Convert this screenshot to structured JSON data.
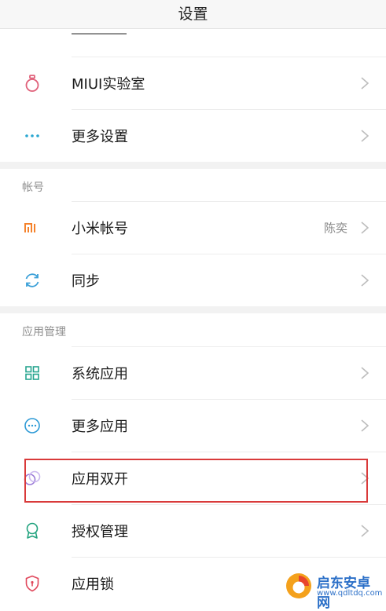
{
  "header": {
    "title": "设置"
  },
  "colors": {
    "accent_red": "#d93a3a",
    "section_gap": "#f2f2f2",
    "divider": "#ececec",
    "watermark": "#2c70c8"
  },
  "rows": [
    {
      "label": "MIUI实验室",
      "icon": "flask-icon",
      "color": "#e0617a"
    },
    {
      "label": "更多设置",
      "icon": "more-dots-icon",
      "color": "#2aa7d1"
    },
    {
      "label": "小米帐号",
      "icon": "mi-logo-icon",
      "color": "#f5822b",
      "value": "陈奕"
    },
    {
      "label": "同步",
      "icon": "sync-icon",
      "color": "#3ba0d8"
    },
    {
      "label": "系统应用",
      "icon": "grid-apps-icon",
      "color": "#27a58f"
    },
    {
      "label": "更多应用",
      "icon": "more-apps-icon",
      "color": "#2d9ad6"
    },
    {
      "label": "应用双开",
      "icon": "dual-apps-icon",
      "color": "#9a7ad7"
    },
    {
      "label": "授权管理",
      "icon": "badge-icon",
      "color": "#23a37f"
    },
    {
      "label": "应用锁",
      "icon": "shield-lock-icon",
      "color": "#e0475b"
    }
  ],
  "sections": {
    "account": "帐号",
    "apps": "应用管理"
  },
  "watermark": {
    "name": "启东安卓网",
    "url": "www.qdltdq.com"
  }
}
